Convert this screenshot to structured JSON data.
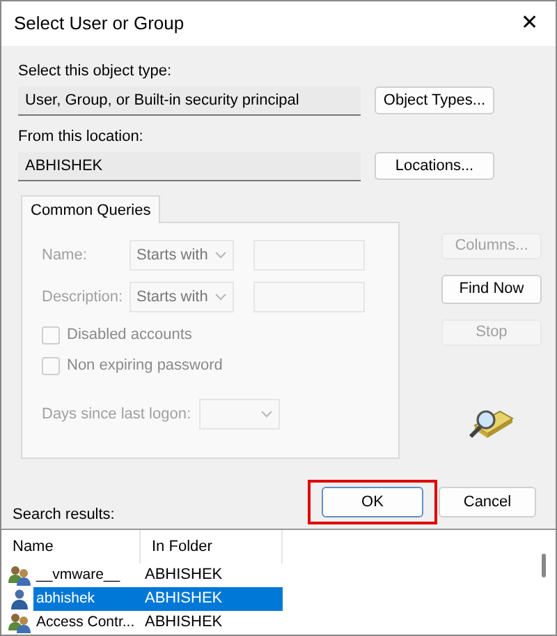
{
  "window": {
    "title": "Select User or Group",
    "close": "✕"
  },
  "object_type": {
    "label": "Select this object type:",
    "value": "User, Group, or Built-in security principal",
    "button": "Object Types..."
  },
  "location": {
    "label": "From this location:",
    "value": "ABHISHEK",
    "button": "Locations..."
  },
  "tabs": [
    {
      "label": "Common Queries",
      "selected": true
    }
  ],
  "queries": {
    "rows": [
      {
        "label": "Name:",
        "mode": "Starts with",
        "disabled": true
      },
      {
        "label": "Description:",
        "mode": "Starts with",
        "disabled": true
      }
    ],
    "checkboxes": [
      {
        "label": "Disabled accounts",
        "checked": false,
        "disabled": true
      },
      {
        "label": "Non expiring password",
        "checked": false,
        "disabled": true
      }
    ],
    "days": {
      "label": "Days since last logon:",
      "disabled": true
    }
  },
  "side_buttons": [
    {
      "label": "Columns...",
      "disabled": true
    },
    {
      "label": "Find Now",
      "disabled": false
    },
    {
      "label": "Stop",
      "disabled": true
    }
  ],
  "dialog_buttons": [
    {
      "label": "OK",
      "highlighted": true
    },
    {
      "label": "Cancel",
      "highlighted": false
    }
  ],
  "results": {
    "label": "Search results:",
    "columns": [
      "Name",
      "In Folder"
    ],
    "rows": [
      {
        "kind": "group",
        "name": "__vmware__",
        "folder": "ABHISHEK",
        "selected": false
      },
      {
        "kind": "user",
        "name": "abhishek",
        "folder": "ABHISHEK",
        "selected": true
      },
      {
        "kind": "group",
        "name": "Access Contr...",
        "folder": "ABHISHEK",
        "selected": false
      }
    ]
  }
}
